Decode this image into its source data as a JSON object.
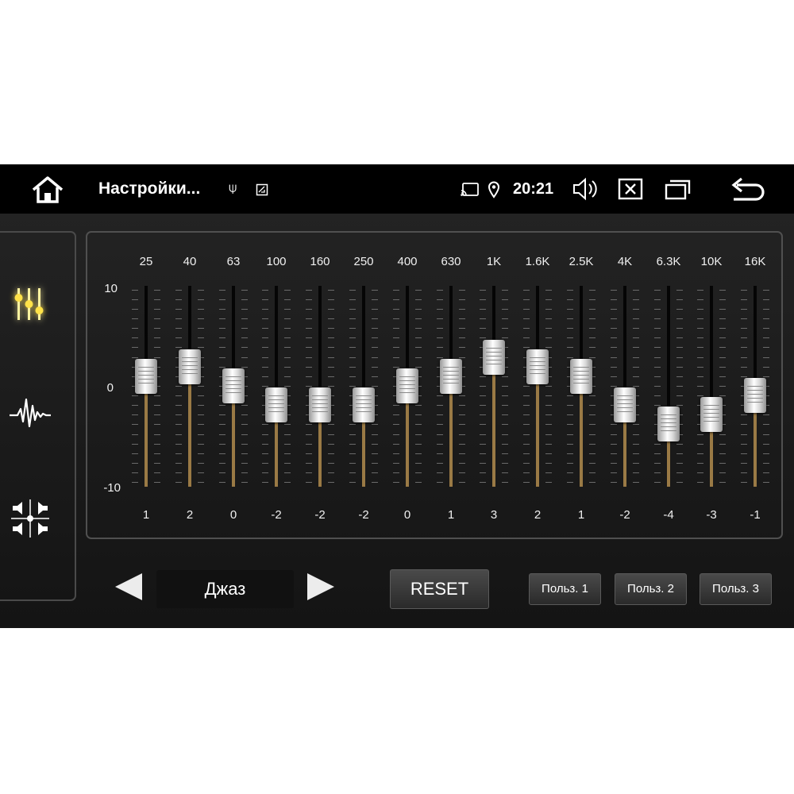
{
  "status_bar": {
    "title": "Настройки...",
    "time": "20:21",
    "icons": [
      "home-icon",
      "usb-icon",
      "photo-icon",
      "cast-icon",
      "location-icon",
      "volume-icon",
      "close-box-icon",
      "windows-icon",
      "back-icon"
    ]
  },
  "sidebar": {
    "items": [
      "equalizer-icon",
      "waveform-icon",
      "balance-icon"
    ],
    "active": 0
  },
  "equalizer": {
    "scale": {
      "top": "10",
      "mid": "0",
      "bottom": "-10"
    },
    "range": [
      -10,
      10
    ],
    "bands": [
      {
        "freq": "25",
        "value": "1"
      },
      {
        "freq": "40",
        "value": "2"
      },
      {
        "freq": "63",
        "value": "0"
      },
      {
        "freq": "100",
        "value": "-2"
      },
      {
        "freq": "160",
        "value": "-2"
      },
      {
        "freq": "250",
        "value": "-2"
      },
      {
        "freq": "400",
        "value": "0"
      },
      {
        "freq": "630",
        "value": "1"
      },
      {
        "freq": "1K",
        "value": "3"
      },
      {
        "freq": "1.6K",
        "value": "2"
      },
      {
        "freq": "2.5K",
        "value": "1"
      },
      {
        "freq": "4K",
        "value": "-2"
      },
      {
        "freq": "6.3K",
        "value": "-4"
      },
      {
        "freq": "10K",
        "value": "-3"
      },
      {
        "freq": "16K",
        "value": "-1"
      }
    ]
  },
  "controls": {
    "preset": "Джаз",
    "reset_label": "RESET",
    "user1_label": "Польз. 1",
    "user2_label": "Польз. 2",
    "user3_label": "Польз. 3"
  },
  "colors": {
    "accent_glow": "#ffe24a",
    "track_lower": "#9a7a45",
    "track_upper": "#050505"
  }
}
